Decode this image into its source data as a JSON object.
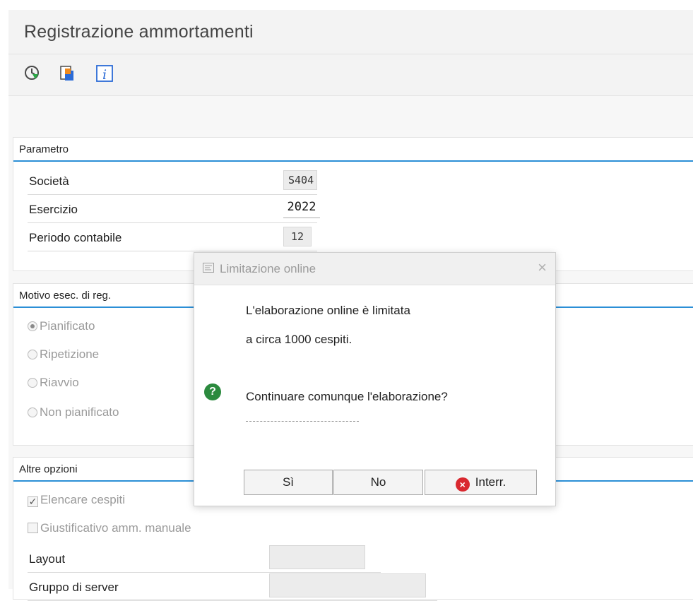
{
  "header": {
    "title": "Registrazione ammortamenti"
  },
  "toolbar": {
    "execute_icon": "execute-clock-icon",
    "copy_icon": "multiple-selection-icon",
    "info_icon": "info-icon"
  },
  "parametro": {
    "title": "Parametro",
    "fields": [
      {
        "label": "Società",
        "value": "S404"
      },
      {
        "label": "Esercizio",
        "value": "2022"
      },
      {
        "label": "Periodo contabile",
        "value": "12"
      }
    ]
  },
  "motivo": {
    "title": "Motivo esec. di reg.",
    "options": [
      {
        "label": "Pianificato",
        "selected": true
      },
      {
        "label": "Ripetizione",
        "selected": false
      },
      {
        "label": "Riavvio",
        "selected": false
      },
      {
        "label": "Non pianificato",
        "selected": false
      }
    ]
  },
  "altre": {
    "title": "Altre opzioni",
    "elencare_label": "Elencare cespiti",
    "elencare_checked": "✓",
    "giustificativo_label": "Giustificativo amm. manuale",
    "layout_label": "Layout",
    "gruppo_label": "Gruppo di server"
  },
  "dialog": {
    "title": "Limitazione online",
    "close": "×",
    "line1": "L'elaborazione online è limitata",
    "line2": "a circa 1000  cespiti.",
    "question": "Continuare comunque l'elaborazione?",
    "question_icon": "?",
    "btn_yes": "Sì",
    "btn_no": "No",
    "btn_cancel": "Interr.",
    "cancel_icon": "×"
  },
  "colors": {
    "accent_blue": "#2b8fd6",
    "question_green": "#2b8a3e",
    "cancel_red": "#d9282f"
  }
}
